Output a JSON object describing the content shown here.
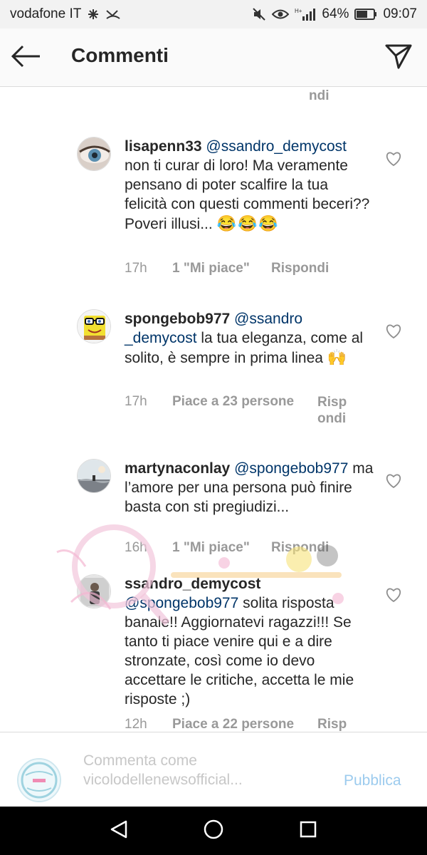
{
  "status_bar": {
    "carrier": "vodafone IT",
    "signal_label": "H+",
    "battery": "64%",
    "time": "09:07"
  },
  "header": {
    "title": "Commenti",
    "back_icon": "arrow-left-icon",
    "send_icon": "paper-plane-icon"
  },
  "top_fragment": {
    "reply_tail": "ndi"
  },
  "comments": [
    {
      "username": "lisapenn33",
      "mention": "@ssandro_demycost",
      "text": "non ti curar di loro! Ma veramente pensano di poter scalfire la tua felicità con questi commenti beceri?? Poveri illusi...",
      "emoji": "😂😂😂",
      "time": "17h",
      "likes": "1 \"Mi piace\"",
      "reply": "Rispondi"
    },
    {
      "username": "spongebob977",
      "mention_a": "@ssandro",
      "mention_b": "_demycost",
      "text": "la tua eleganza, come al solito, è sempre in prima linea",
      "emoji": "🙌",
      "time": "17h",
      "likes": "Piace a 23 persone",
      "reply_a": "Risp",
      "reply_b": "ondi"
    },
    {
      "username": "martynaconlay",
      "mention": "@spongebob977",
      "text": "ma l’amore per una persona può finire basta con sti pregiudizi...",
      "time": "16h",
      "likes": "1 \"Mi piace\"",
      "reply": "Rispondi"
    },
    {
      "username": "ssandro_demycost",
      "mention": "@spongebob977",
      "text": "solita risposta banale!! Aggiornatevi ragazzi!!! Se tanto ti piace venire qui e a dire stronzate, così come io devo accettare le critiche, accetta le mie risposte ;)",
      "time": "12h",
      "likes": "Piace a 22 persone",
      "reply": "Risp"
    }
  ],
  "input_bar": {
    "placeholder_line1": "Commenta come",
    "placeholder_line2": "vicolodellenewsofficial...",
    "post_label": "Pubblica"
  },
  "nav": {
    "back_icon": "triangle-back-icon",
    "home_icon": "circle-home-icon",
    "recents_icon": "square-recents-icon"
  },
  "colors": {
    "mention": "#003569",
    "meta_gray": "#999999",
    "post_blue": "#9ccbee",
    "header_bg": "#fafafa"
  }
}
